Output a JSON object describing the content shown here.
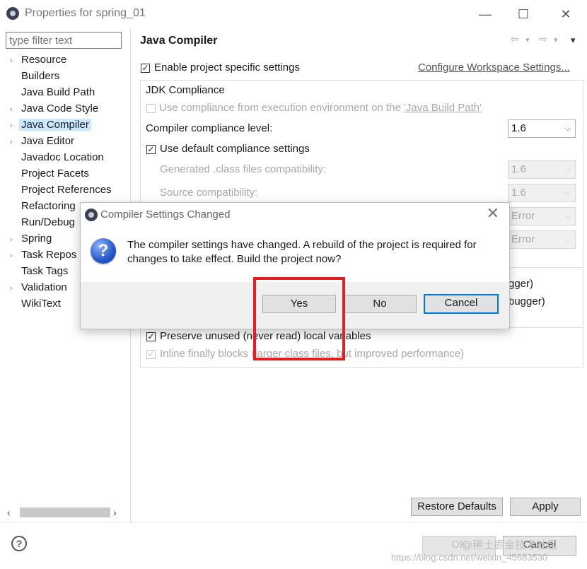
{
  "window": {
    "title": "Properties for spring_01",
    "minimize": "—",
    "maximize": "☐",
    "close": "✕"
  },
  "filter": {
    "placeholder": "type filter text"
  },
  "tree": [
    {
      "label": "Resource",
      "arrow": "›"
    },
    {
      "label": "Builders",
      "arrow": ""
    },
    {
      "label": "Java Build Path",
      "arrow": ""
    },
    {
      "label": "Java Code Style",
      "arrow": "›"
    },
    {
      "label": "Java Compiler",
      "arrow": "›",
      "selected": true
    },
    {
      "label": "Java Editor",
      "arrow": "›"
    },
    {
      "label": "Javadoc Location",
      "arrow": ""
    },
    {
      "label": "Project Facets",
      "arrow": ""
    },
    {
      "label": "Project References",
      "arrow": ""
    },
    {
      "label": "Refactoring",
      "arrow": ""
    },
    {
      "label": "Run/Debug",
      "arrow": ""
    },
    {
      "label": "Spring",
      "arrow": "›"
    },
    {
      "label": "Task Repos",
      "arrow": "›"
    },
    {
      "label": "Task Tags",
      "arrow": ""
    },
    {
      "label": "Validation",
      "arrow": "›"
    },
    {
      "label": "WikiText",
      "arrow": ""
    }
  ],
  "main": {
    "title": "Java Compiler",
    "nav": {
      "back": "⇦",
      "back_menu": "▾",
      "forward": "⇨",
      "forward_menu": "▾",
      "view_menu": "▾"
    },
    "enable_project": {
      "label": "Enable project specific settings",
      "checked": "✓"
    },
    "configure_link": "Configure Workspace Settings...",
    "jdk_group": "JDK Compliance",
    "use_compliance_prefix": "Use compliance from execution environment on the ",
    "use_compliance_link": "'Java Build Path'",
    "compliance_level": {
      "label": "Compiler compliance level:",
      "value": "1.6"
    },
    "use_default": {
      "label": "Use default compliance settings",
      "checked": "✓"
    },
    "generated_class": {
      "label": "Generated .class files compatibility:",
      "value": "1.6"
    },
    "source_compat": {
      "label": "Source compatibility:",
      "value": "1.6"
    },
    "error1": "Error",
    "error2": "Error",
    "right_fragment1": "gger)",
    "right_fragment2": "bugger)",
    "preserve_unused": {
      "label": "Preserve unused (never read) local variables",
      "checked": "✓"
    },
    "inline_finally": {
      "label": "Inline finally blocks (larger class files, but improved performance)",
      "checked": "✓"
    }
  },
  "buttons": {
    "restore_defaults": "Restore Defaults",
    "apply": "Apply",
    "ok": "OK",
    "cancel": "Cancel",
    "help": "?"
  },
  "dialog": {
    "title": "Compiler Settings Changed",
    "close": "✕",
    "icon": "?",
    "message": "The compiler settings have changed. A rebuild of the project is required for changes to take effect. Build the project now?",
    "yes": "Yes",
    "no": "No",
    "cancel": "Cancel"
  },
  "watermark": {
    "brand": "@稀土掘金技术社区",
    "url": "https://blog.csdn.net/weixin_45683530"
  },
  "colors": {
    "selection": "#cce8ff",
    "highlight_box": "#e02020",
    "default_button_border": "#0078d7"
  }
}
